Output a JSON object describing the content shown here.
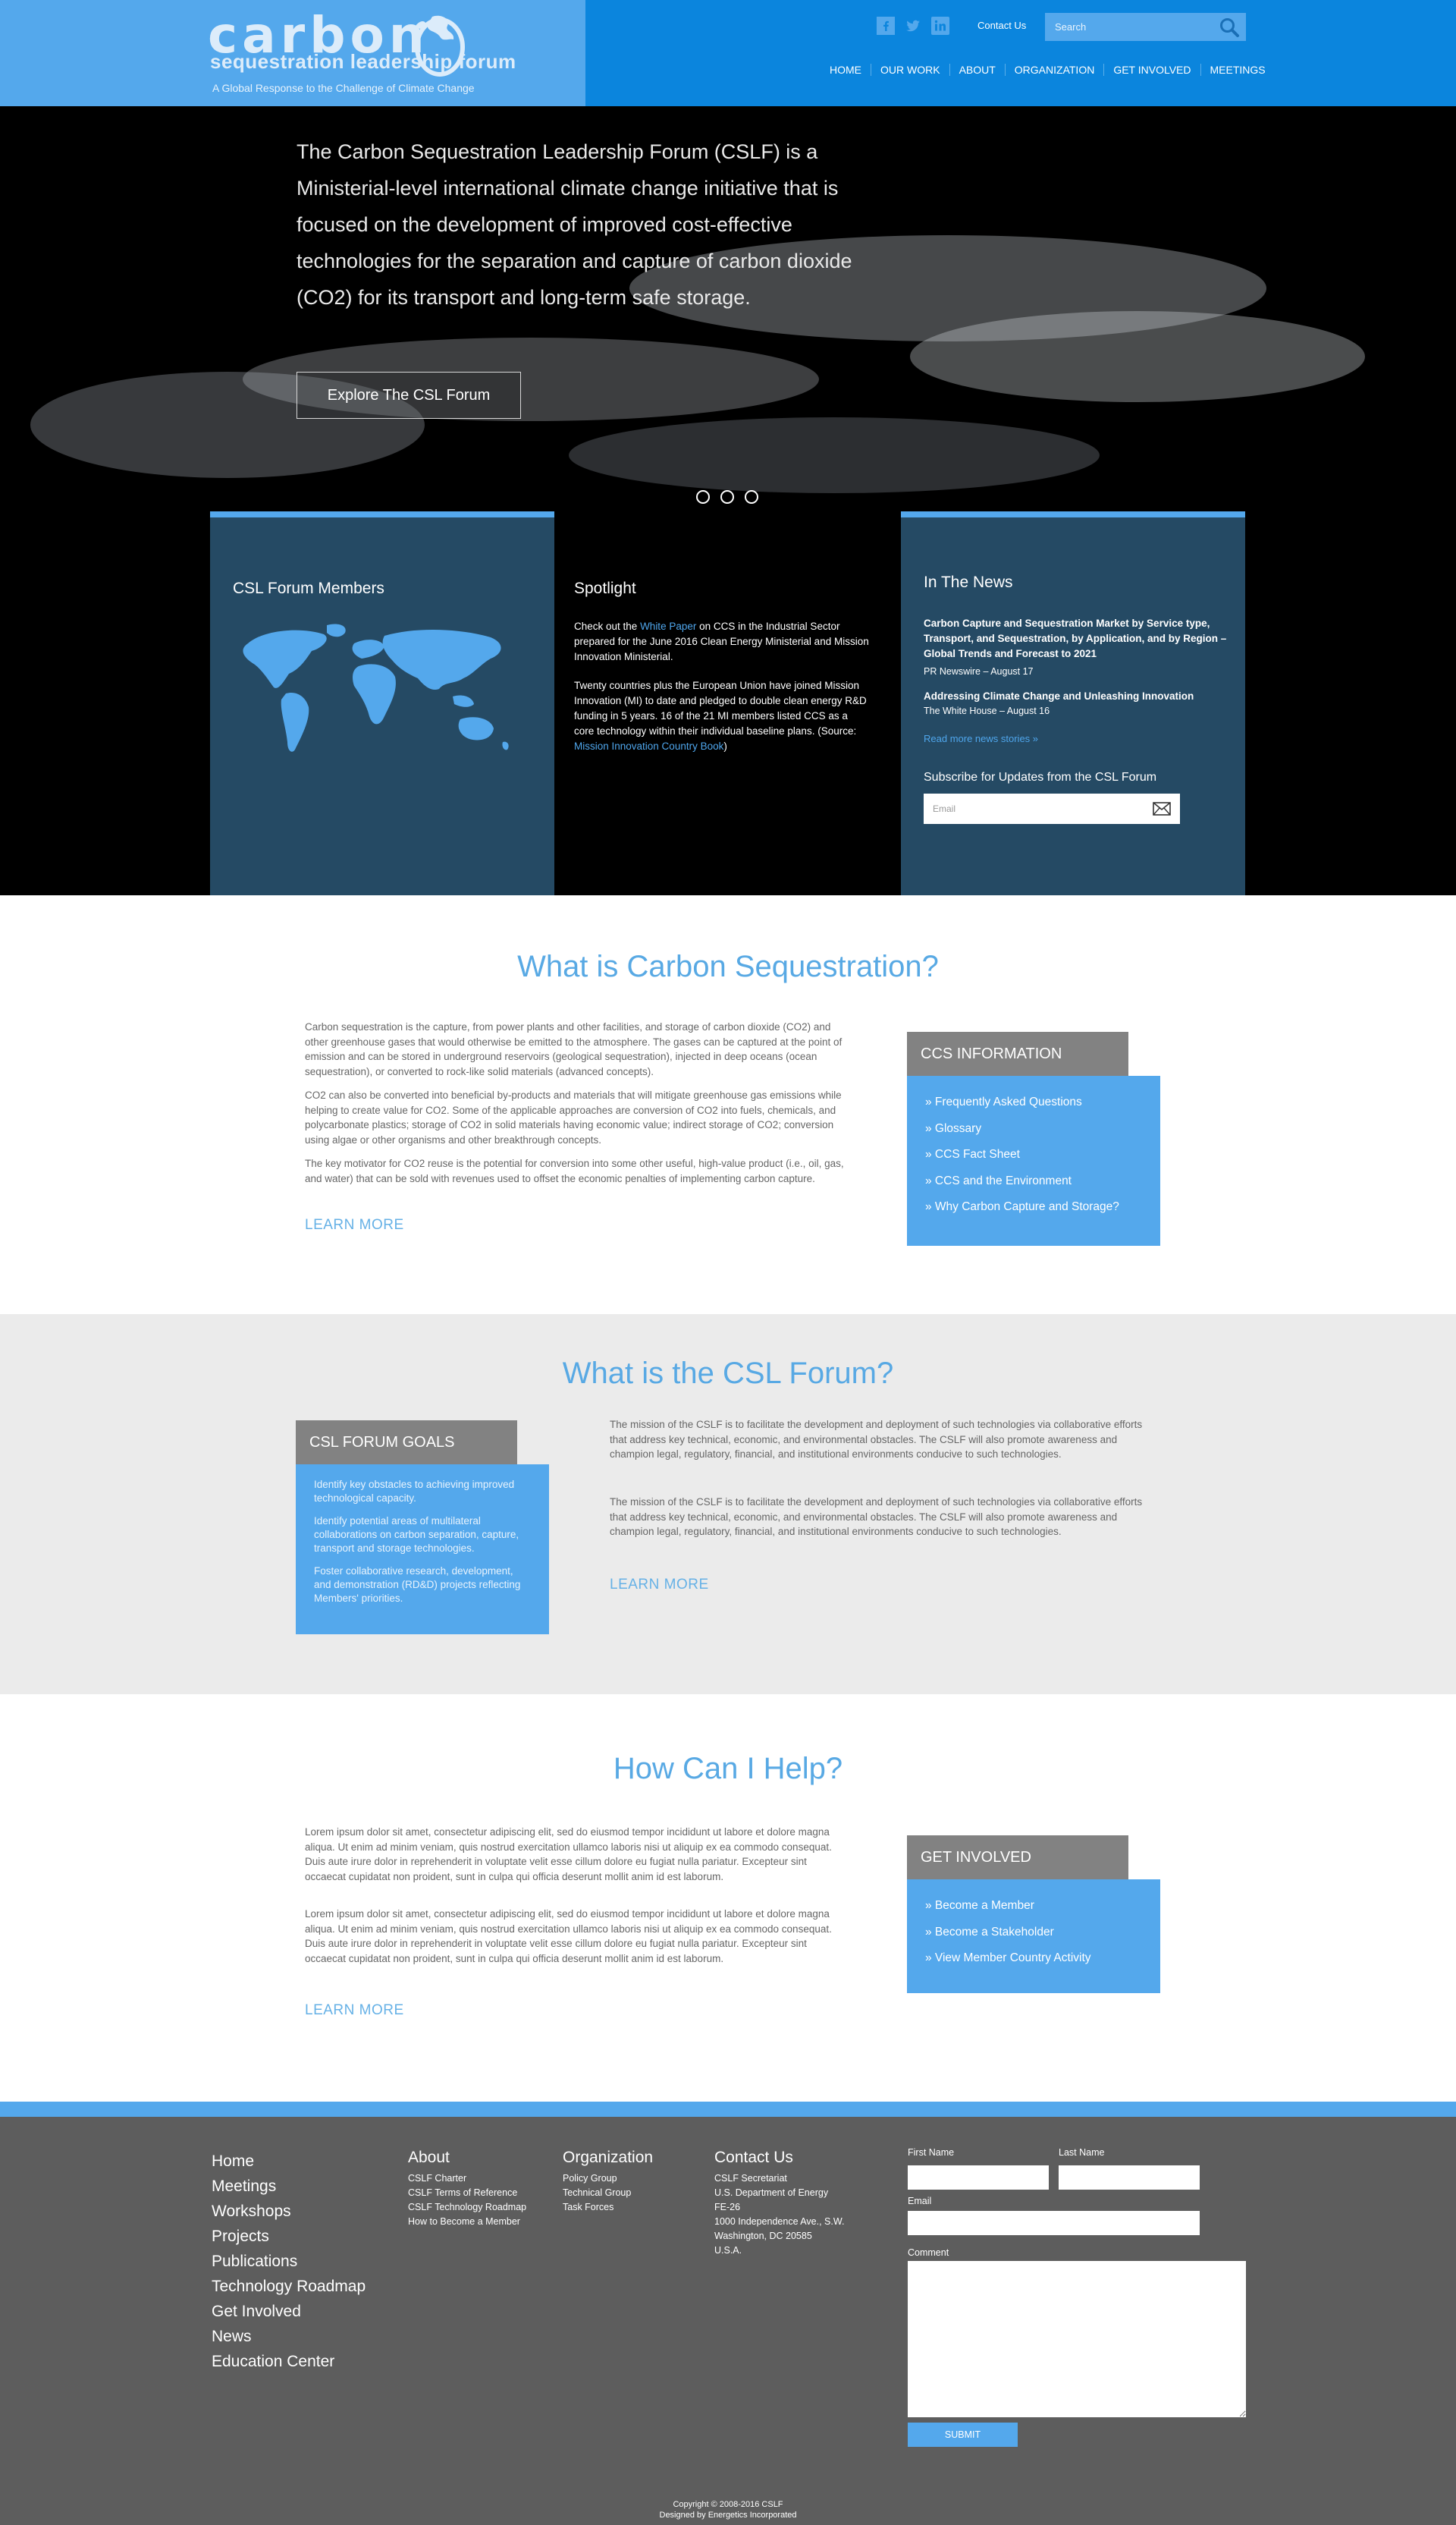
{
  "colors": {
    "brand_blue": "#0b85dd",
    "light_blue": "#54a8ec",
    "panel_navy": "#254a64",
    "footer_gray": "#5d5d5d",
    "tab_gray": "#828282"
  },
  "header": {
    "logo_word": "carbon",
    "logo_sub": "sequestration leadership forum",
    "tagline": "A Global Response to the Challenge of Climate Change",
    "social_icons": [
      "facebook-icon",
      "twitter-icon",
      "linkedin-icon"
    ],
    "contact_us": "Contact Us",
    "search_placeholder": "Search",
    "nav": [
      "HOME",
      "OUR WORK",
      "ABOUT",
      "ORGANIZATION",
      "GET INVOLVED",
      "MEETINGS"
    ]
  },
  "hero": {
    "text": "The Carbon Sequestration Leadership Forum (CSLF) is a Ministerial-level international climate change initiative that is focused on the development of improved cost-effective technologies for the separation and capture of carbon dioxide (CO2) for its transport and long-term safe storage.",
    "button": "Explore The CSL Forum"
  },
  "members": {
    "title": "CSL Forum Members"
  },
  "spotlight": {
    "title": "Spotlight",
    "p1_pre": "Check out the ",
    "p1_link": "White Paper",
    "p1_post": " on CCS in the Industrial Sector prepared for the June 2016 Clean Energy Ministerial and Mission Innovation Ministerial.",
    "p2_pre": "Twenty countries plus the European Union have joined Mission Innovation (MI) to date and pledged to double clean energy R&D funding in 5 years. 16 of the 21 MI members listed CCS as a core technology within their individual baseline plans. (Source: ",
    "p2_link": "Mission Innovation Country Book",
    "p2_post": ")"
  },
  "news": {
    "title": "In The News",
    "items": [
      {
        "headline": "Carbon Capture and Sequestration Market by Service type, Transport, and Sequestration, by Application, and by Region – Global Trends and Forecast to 2021",
        "source": "PR Newswire – August 17"
      },
      {
        "headline": "Addressing Climate Change and Unleashing Innovation",
        "source": "The White House – August 16"
      }
    ],
    "more": "Read more news stories »",
    "subscribe_title": "Subscribe for Updates from the CSL Forum",
    "email_placeholder": "Email"
  },
  "carbon": {
    "title": "What is Carbon Sequestration?",
    "paragraphs": [
      "Carbon sequestration is the capture, from power plants and other facilities, and storage of carbon dioxide (CO2) and other greenhouse gases that would otherwise be emitted to the atmosphere. The gases can be captured at the point of emission and can be stored in underground reservoirs (geological sequestration), injected in deep oceans (ocean sequestration), or converted to rock-like solid materials (advanced concepts).",
      "CO2 can also be converted into beneficial by-products and materials that will mitigate greenhouse gas emissions while helping to create value for CO2. Some of the applicable approaches are conversion of CO2 into fuels, chemicals, and polycarbonate plastics; storage of CO2 in solid materials having economic value; indirect storage of CO2; conversion using algae or other organisms and other breakthrough concepts.",
      "The key motivator for CO2 reuse is the potential for conversion into some other useful, high-value product (i.e., oil, gas, and water) that can be sold with revenues used to offset the economic penalties of implementing carbon capture."
    ],
    "learn_more": "LEARN MORE",
    "box_title": "CCS INFORMATION",
    "links": [
      "» Frequently Asked Questions",
      "» Glossary",
      "» CCS Fact Sheet",
      "» CCS and the Environment",
      "» Why Carbon Capture and Storage?"
    ]
  },
  "forum": {
    "title": "What is the CSL Forum?",
    "box_title": "CSL FORUM GOALS",
    "goals": [
      "Identify key obstacles to achieving improved technological capacity.",
      "Identify potential areas of multilateral collaborations on carbon separation, capture, transport and storage technologies.",
      "Foster collaborative research, development, and demonstration (RD&D) projects reflecting Members' priorities."
    ],
    "paragraphs": [
      "The mission of the CSLF is to facilitate the development and deployment of such technologies via collaborative efforts that address key technical, economic, and environmental obstacles. The CSLF will also promote awareness and champion legal, regulatory, financial, and institutional environments conducive to such technologies.",
      "The mission of the CSLF is to facilitate the development and deployment of such technologies via collaborative efforts that address key technical, economic, and environmental obstacles. The CSLF will also promote awareness and champion legal, regulatory, financial, and institutional environments conducive to such technologies."
    ],
    "learn_more": "LEARN MORE"
  },
  "help": {
    "title": "How Can I Help?",
    "paragraphs": [
      "Lorem ipsum dolor sit amet, consectetur adipiscing elit, sed do eiusmod tempor incididunt ut labore et dolore magna aliqua. Ut enim ad minim veniam, quis nostrud exercitation ullamco laboris nisi ut aliquip ex ea commodo consequat. Duis aute irure dolor in reprehenderit in voluptate velit esse cillum dolore eu fugiat nulla pariatur. Excepteur sint occaecat cupidatat non proident, sunt in culpa qui officia deserunt mollit anim id est laborum.",
      "Lorem ipsum dolor sit amet, consectetur adipiscing elit, sed do eiusmod tempor incididunt ut labore et dolore magna aliqua. Ut enim ad minim veniam, quis nostrud exercitation ullamco laboris nisi ut aliquip ex ea commodo consequat. Duis aute irure dolor in reprehenderit in voluptate velit esse cillum dolore eu fugiat nulla pariatur. Excepteur sint occaecat cupidatat non proident, sunt in culpa qui officia deserunt mollit anim id est laborum."
    ],
    "learn_more": "LEARN MORE",
    "box_title": "GET INVOLVED",
    "links": [
      "» Become a Member",
      "» Become a Stakeholder",
      "» View Member Country Activity"
    ]
  },
  "footer": {
    "main_links": [
      "Home",
      "Meetings",
      "Workshops",
      "Projects",
      "Publications",
      "Technology Roadmap",
      "Get Involved",
      "News",
      "Education Center"
    ],
    "about": {
      "title": "About",
      "links": [
        "CSLF Charter",
        "CSLF Terms of Reference",
        "CSLF Technology Roadmap",
        "How to Become a Member"
      ]
    },
    "organization": {
      "title": "Organization",
      "links": [
        "Policy Group",
        "Technical Group",
        "Task Forces"
      ]
    },
    "contact": {
      "title": "Contact Us",
      "lines": [
        "CSLF Secretariat",
        "U.S. Department of Energy",
        "FE-26",
        "1000 Independence Ave., S.W.",
        "Washington, DC 20585",
        "U.S.A."
      ]
    },
    "form": {
      "first_name": "First Name",
      "last_name": "Last Name",
      "email": "Email",
      "comment": "Comment",
      "submit": "SUBMIT"
    },
    "copyright": "Copyright © 2008-2016 CSLF",
    "designed_by": "Designed by Energetics Incorporated"
  }
}
